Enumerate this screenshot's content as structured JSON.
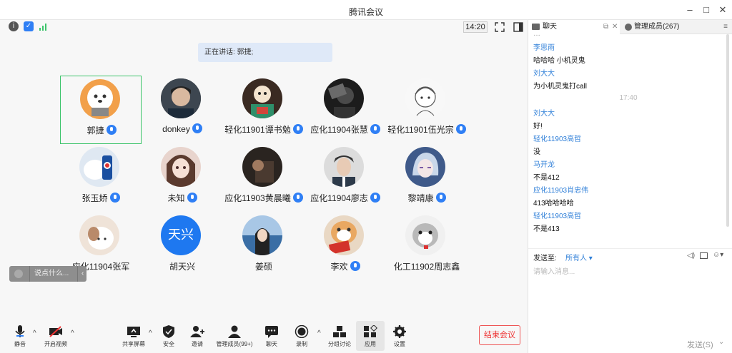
{
  "window": {
    "title": "腾讯会议"
  },
  "meeting": {
    "time": "14:20",
    "speaking": "正在讲话: 郭捷;",
    "participants": [
      {
        "name": "郭捷",
        "mic": true
      },
      {
        "name": "donkey",
        "mic": true
      },
      {
        "name": "轻化11901谭书勉",
        "mic": true
      },
      {
        "name": "应化11904张慧",
        "mic": true
      },
      {
        "name": "轻化11901伍光宗",
        "mic": true
      },
      {
        "name": "张玉娇",
        "mic": true
      },
      {
        "name": "未知",
        "mic": true
      },
      {
        "name": "应化11903黄晨曦",
        "mic": true
      },
      {
        "name": "应化11904廖志",
        "mic": true
      },
      {
        "name": "黎靖康",
        "mic": true
      },
      {
        "name": "应化11904张军",
        "mic": false
      },
      {
        "name": "胡天兴",
        "mic": false
      },
      {
        "name": "姜硕",
        "mic": false
      },
      {
        "name": "李欢",
        "mic": true
      },
      {
        "name": "化工11902周志鑫",
        "mic": false
      }
    ],
    "avatar_text": "天兴",
    "say_placeholder": "说点什么...",
    "toolbar": {
      "mute": "静音",
      "video": "开启视频",
      "share": "共享屏幕",
      "security": "安全",
      "invite": "邀请",
      "members": "管理成员(99+)",
      "chat": "聊天",
      "record": "录制",
      "breakout": "分组讨论",
      "apps": "应用",
      "settings": "设置",
      "end": "结束会议"
    }
  },
  "side": {
    "tab_chat": "聊天",
    "tab_members": "管理成员(267)",
    "messages": [
      {
        "sender": "李思雨",
        "text": "哈哈哈 小机灵鬼"
      },
      {
        "sender": "刘大大",
        "text": "为小机灵鬼打call"
      },
      {
        "timestamp": "17:40"
      },
      {
        "sender": "刘大大",
        "text": "好!"
      },
      {
        "sender": "轻化11903高哲",
        "text": "没"
      },
      {
        "sender": "马开龙",
        "text": "不是412"
      },
      {
        "sender": "应化11903肖忠伟",
        "text": "413哈哈哈哈"
      },
      {
        "sender": "轻化11903高哲",
        "text": "不是413"
      }
    ],
    "send_to_label": "发送至:",
    "send_to_value": "所有人",
    "input_placeholder": "请输入消息...",
    "send_button": "发送(S)"
  },
  "colors": {
    "accent": "#2f7ff5",
    "end_red": "#e33333",
    "active_border": "#3cc46a",
    "sender_blue": "#2f7fd8"
  }
}
